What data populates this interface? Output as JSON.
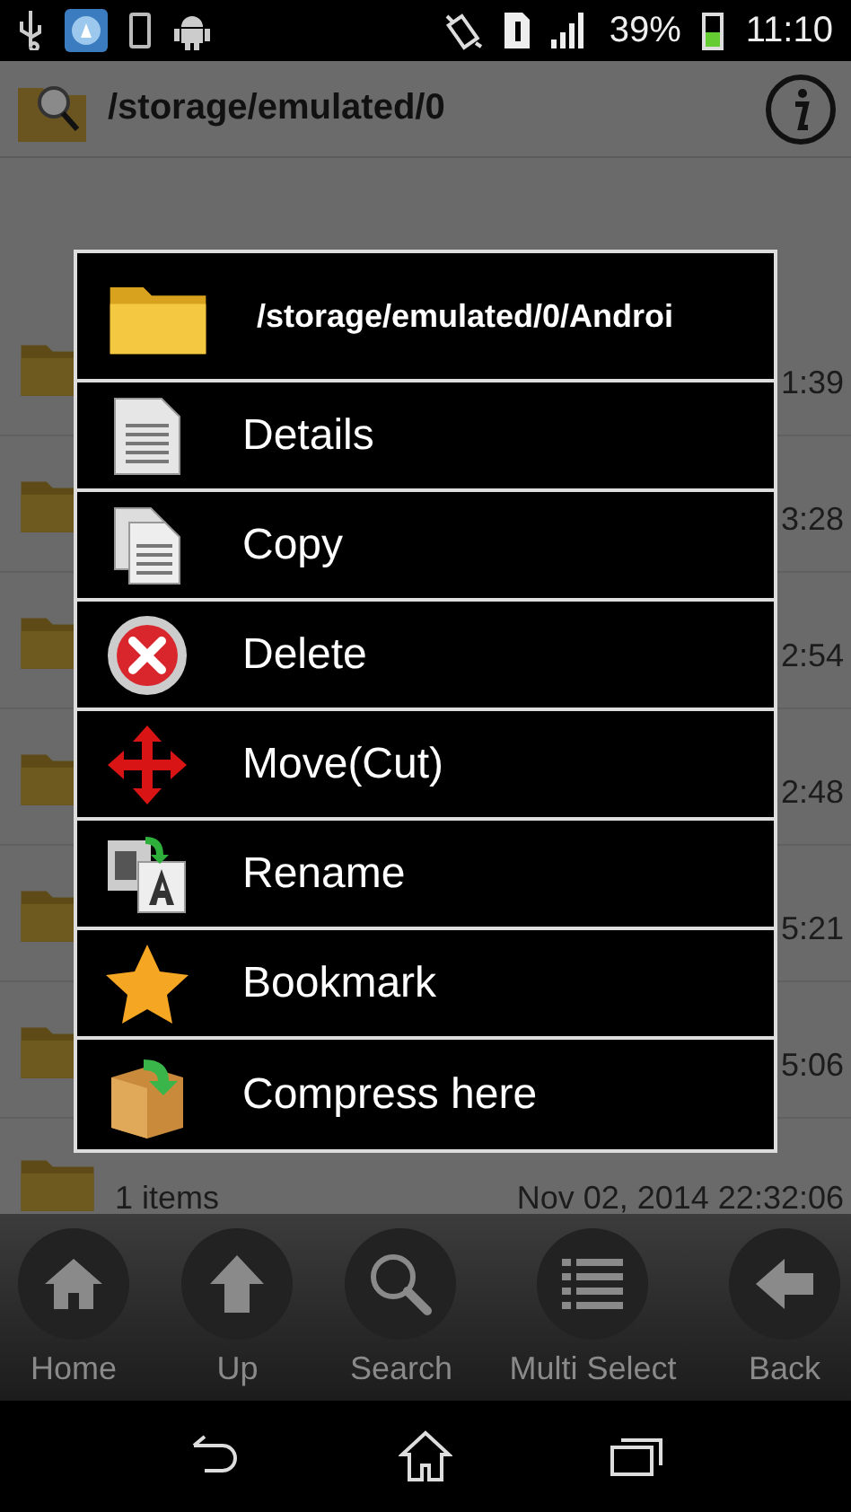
{
  "status_bar": {
    "battery": "39%",
    "time": "11:10"
  },
  "header": {
    "path": "/storage/emulated/0"
  },
  "file_rows": [
    {
      "time": "1:39"
    },
    {
      "time": "3:28"
    },
    {
      "time": "2:54"
    },
    {
      "time": "2:48"
    },
    {
      "time": "5:21"
    },
    {
      "time": "5:06"
    },
    {
      "info": "1 items",
      "time": "Nov 02, 2014 22:32:06"
    }
  ],
  "dialog": {
    "title": "/storage/emulated/0/Androi",
    "items": [
      {
        "kind": "details",
        "label": "Details"
      },
      {
        "kind": "copy",
        "label": "Copy"
      },
      {
        "kind": "delete",
        "label": "Delete"
      },
      {
        "kind": "move",
        "label": "Move(Cut)"
      },
      {
        "kind": "rename",
        "label": "Rename"
      },
      {
        "kind": "bookmark",
        "label": "Bookmark"
      },
      {
        "kind": "compress",
        "label": "Compress here"
      }
    ]
  },
  "toolbar": [
    {
      "kind": "home",
      "label": "Home"
    },
    {
      "kind": "up",
      "label": "Up"
    },
    {
      "kind": "search",
      "label": "Search"
    },
    {
      "kind": "multi",
      "label": "Multi Select"
    },
    {
      "kind": "back",
      "label": "Back"
    }
  ]
}
